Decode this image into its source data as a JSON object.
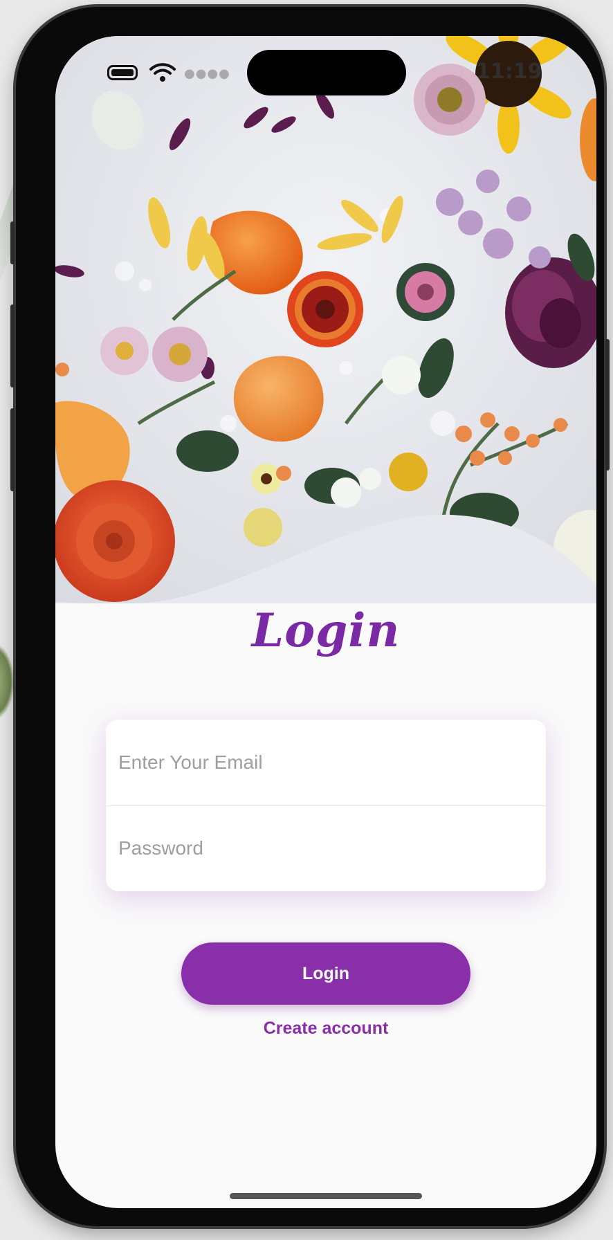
{
  "status_bar": {
    "time": "11:19",
    "icons": [
      "battery-icon",
      "wifi-icon",
      "signal-icon"
    ]
  },
  "hero": {
    "image": "flowers-on-white-cloth-photo"
  },
  "title": "Login",
  "form": {
    "email_placeholder": "Enter Your Email",
    "email_value": "",
    "password_placeholder": "Password",
    "password_value": ""
  },
  "actions": {
    "login_label": "Login",
    "create_account_label": "Create account"
  },
  "colors": {
    "accent": "#8a2faa",
    "title": "#7b2aa6",
    "background": "#fafafa",
    "placeholder": "#9e9e9e"
  }
}
